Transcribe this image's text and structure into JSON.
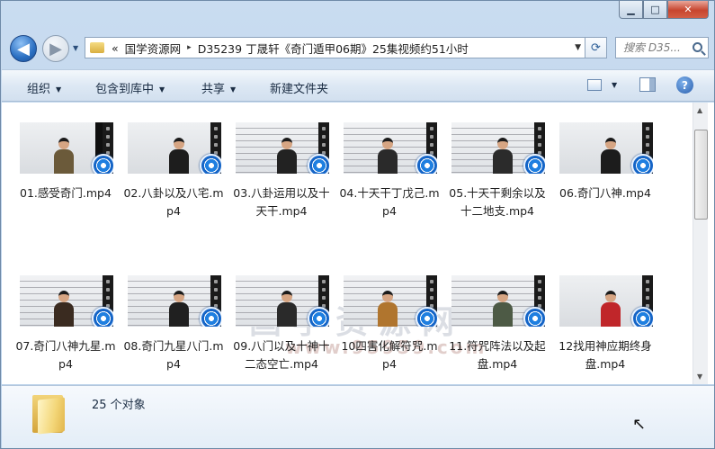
{
  "window": {
    "caption": {
      "min": "▁",
      "max": "□",
      "close": "✕"
    }
  },
  "nav": {
    "back_glyph": "◀",
    "forward_glyph": "▶",
    "address": {
      "overflow": "«",
      "crumbs": [
        "国学资源网",
        "D35239 丁晟轩《奇门遁甲06期》25集视频约51小时"
      ],
      "separator": "▸"
    },
    "search_placeholder": "搜索 D35..."
  },
  "toolbar": {
    "organize": "组织",
    "include_library": "包含到库中",
    "share": "共享",
    "new_folder": "新建文件夹",
    "help": "?"
  },
  "files": [
    {
      "name": "01.感受奇门.mp4"
    },
    {
      "name": "02.八卦以及八宅.mp4"
    },
    {
      "name": "03.八卦运用以及十天干.mp4"
    },
    {
      "name": "04.十天干丁戊己.mp4"
    },
    {
      "name": "05.十天干剩余以及十二地支.mp4"
    },
    {
      "name": "06.奇门八神.mp4"
    },
    {
      "name": "07.奇门八神九星.mp4"
    },
    {
      "name": "08.奇门九星八门.mp4"
    },
    {
      "name": "09.八门以及十神十二态空亡.mp4"
    },
    {
      "name": "10四害化解符咒.mp4"
    },
    {
      "name": "11.符咒阵法以及起盘.mp4"
    },
    {
      "name": "12找用神应期终身盘.mp4"
    }
  ],
  "watermark": {
    "main": "国学资源网",
    "sub": "www.95959.com"
  },
  "status": {
    "count": "25 个对象"
  },
  "colors": {
    "accent": "#2a6fc2",
    "close": "#c7452e",
    "player": "#1565c7"
  }
}
